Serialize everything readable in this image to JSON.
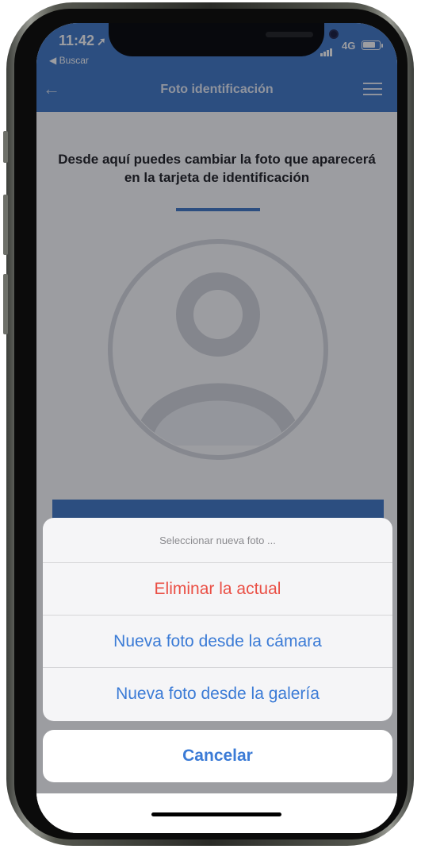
{
  "status_bar": {
    "time": "11:42",
    "back_app": "◀ Buscar",
    "network": "4G"
  },
  "header": {
    "title": "Foto identificación"
  },
  "content": {
    "intro": "Desde aquí puedes cambiar la foto que aparecerá en la tarjeta de identificación"
  },
  "action_sheet": {
    "title": "Seleccionar nueva foto ...",
    "options": [
      {
        "label": "Eliminar la actual",
        "style": "destructive"
      },
      {
        "label": "Nueva foto desde la cámara",
        "style": "default"
      },
      {
        "label": "Nueva foto desde la galería",
        "style": "default"
      }
    ],
    "cancel": "Cancelar"
  },
  "colors": {
    "primary": "#3f78c7",
    "destructive": "#ea4f45",
    "action_blue": "#3b7bd6"
  },
  "icons": [
    "location-arrow-icon",
    "signal-icon",
    "battery-icon",
    "back-arrow-icon",
    "menu-icon",
    "avatar-icon"
  ]
}
